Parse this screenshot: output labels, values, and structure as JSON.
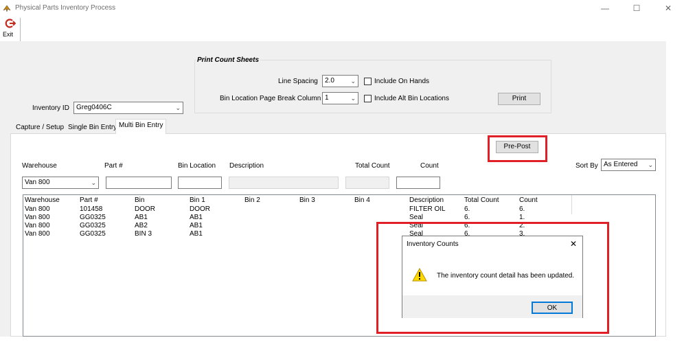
{
  "window": {
    "title": "Physical Parts Inventory Process",
    "minimize": "—",
    "maximize": "☐",
    "close": "✕"
  },
  "toolbar": {
    "exit_label": "Exit"
  },
  "print_count_sheets": {
    "legend": "Print Count Sheets",
    "line_spacing_label": "Line Spacing",
    "line_spacing_value": "2.0",
    "page_break_label": "Bin Location Page Break Column",
    "page_break_value": "1",
    "include_on_hands_label": "Include On Hands",
    "include_alt_bins_label": "Include Alt Bin Locations",
    "print_label": "Print"
  },
  "inventory": {
    "id_label": "Inventory ID",
    "id_value": "Greg0406C"
  },
  "tabs": [
    {
      "label": "Capture / Setup"
    },
    {
      "label": "Single Bin Entry"
    },
    {
      "label": "Multi Bin Entry"
    }
  ],
  "entry": {
    "pre_post_label": "Pre-Post",
    "warehouse_label": "Warehouse",
    "part_label": "Part #",
    "bin_location_label": "Bin Location",
    "description_label": "Description",
    "total_count_label": "Total Count",
    "count_label": "Count",
    "sort_by_label": "Sort By",
    "sort_by_value": "As Entered",
    "warehouse_value": "Van 800"
  },
  "grid": {
    "columns": [
      "Warehouse",
      "Part #",
      "Bin",
      "Bin 1",
      "Bin 2",
      "Bin 3",
      "Bin 4",
      "Description",
      "Total Count",
      "Count"
    ],
    "rows": [
      [
        "Van 800",
        "101458",
        "DOOR",
        "DOOR",
        "",
        "",
        "",
        "FILTER OIL",
        "6.",
        "6."
      ],
      [
        "Van 800",
        "GG0325",
        "AB1",
        "AB1",
        "",
        "",
        "",
        "Seal",
        "6.",
        "1."
      ],
      [
        "Van 800",
        "GG0325",
        "AB2",
        "AB1",
        "",
        "",
        "",
        "Seal",
        "6.",
        "2."
      ],
      [
        "Van 800",
        "GG0325",
        "BIN 3",
        "AB1",
        "",
        "",
        "",
        "Seal",
        "6.",
        "3."
      ]
    ]
  },
  "dialog": {
    "title": "Inventory Counts",
    "message": "The inventory count detail has been updated.",
    "ok_label": "OK",
    "close": "✕"
  },
  "colors": {
    "highlight": "#e11f26",
    "accent": "#0078d7",
    "panel": "#f0f0f0"
  }
}
